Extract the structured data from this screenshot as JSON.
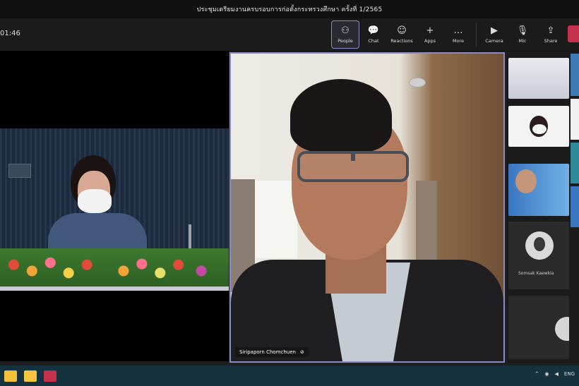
{
  "window": {
    "title": "ประชุมเตรียมงานครบรอบการก่อตั้งกระทรวงศึกษา ครั้งที่ 1/2565"
  },
  "toolbar": {
    "timer": "01:46",
    "buttons": [
      {
        "label": "People",
        "icon": "people-icon",
        "glyph": "⚇"
      },
      {
        "label": "Chat",
        "icon": "chat-icon",
        "glyph": "💬"
      },
      {
        "label": "Reactions",
        "icon": "reactions-icon",
        "glyph": "☺"
      },
      {
        "label": "Apps",
        "icon": "apps-icon",
        "glyph": "+"
      },
      {
        "label": "More",
        "icon": "more-icon",
        "glyph": "…"
      },
      {
        "label": "Camera",
        "icon": "camera-icon",
        "glyph": "▶"
      },
      {
        "label": "Mic",
        "icon": "mic-icon",
        "glyph": "🎙"
      },
      {
        "label": "Share",
        "icon": "share-icon",
        "glyph": "⇪"
      }
    ],
    "leave_color": "#c4314b"
  },
  "main_speaker": {
    "name": "Siripaporn Chomchuen"
  },
  "gallery": {
    "participants": [
      {
        "name": "Somsak Kaewkla"
      }
    ]
  },
  "taskbar": {
    "apps": [
      "folder-icon",
      "file-explorer-icon",
      "teams-icon"
    ],
    "tray_lang": "ENG",
    "accent": "#16323f"
  }
}
